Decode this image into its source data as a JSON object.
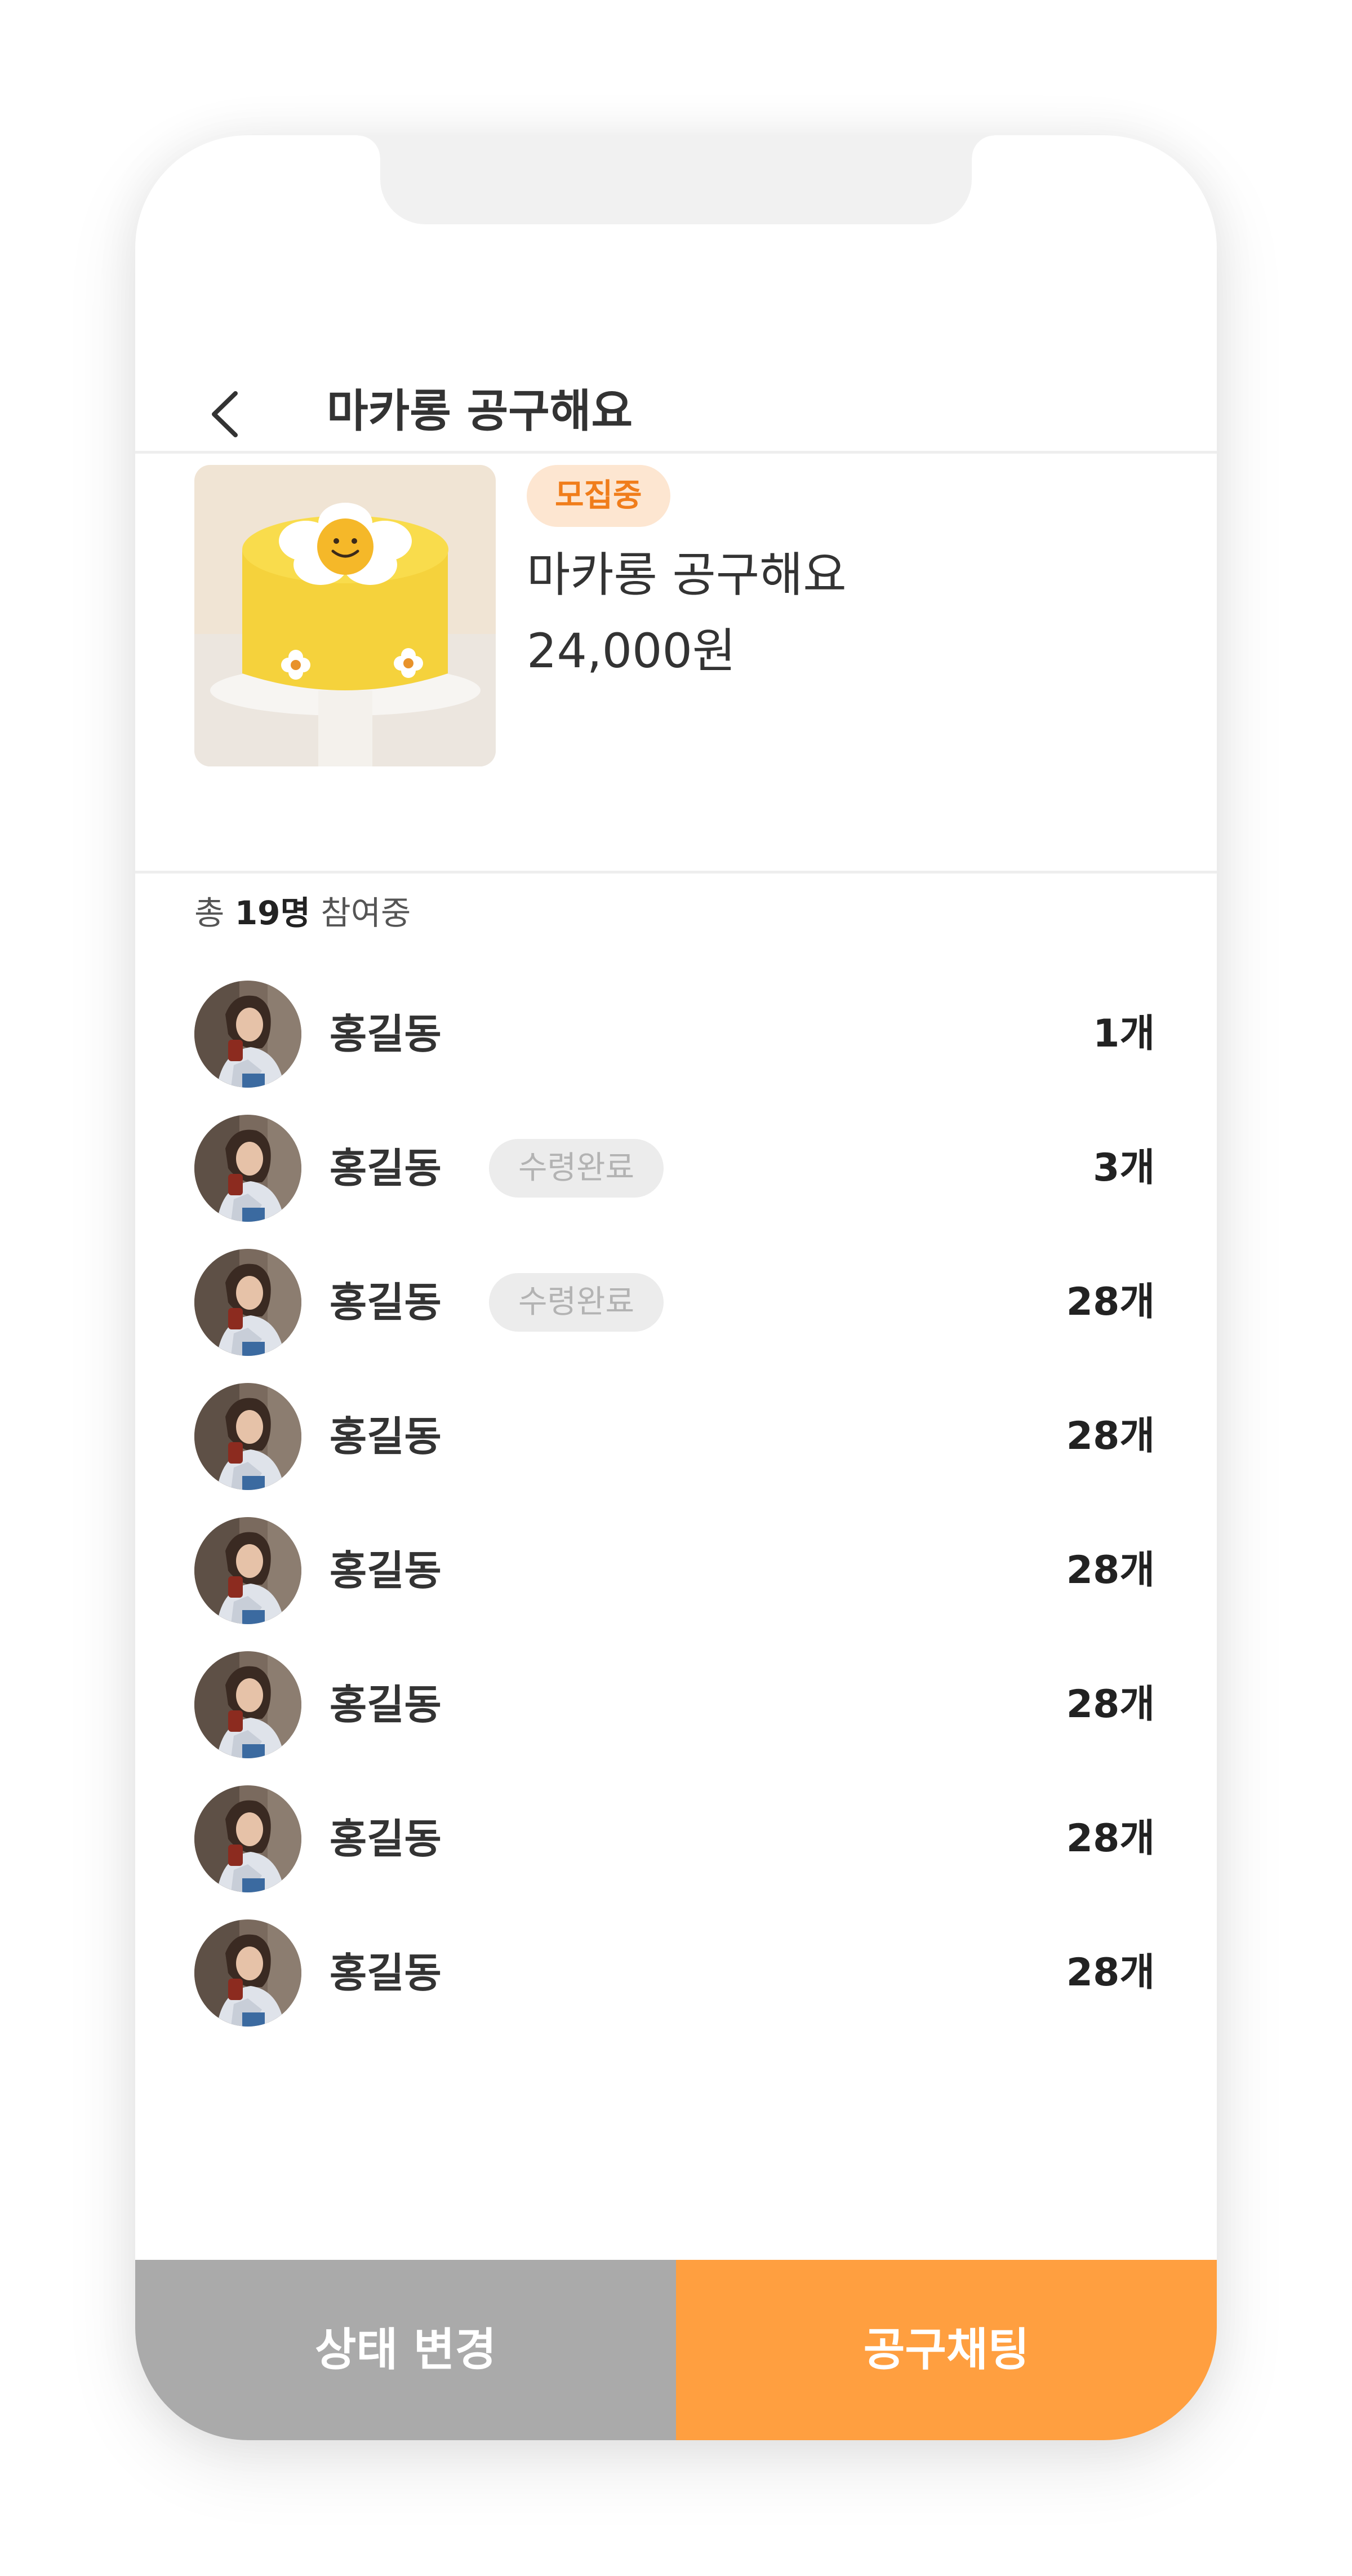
{
  "header": {
    "title": "마카롱 공구해요",
    "back_icon": "chevron-left-icon"
  },
  "product": {
    "status_badge": "모집중",
    "name": "마카롱 공구해요",
    "price": "24,000원",
    "image": "yellow-flower-cake-image"
  },
  "participants": {
    "summary_prefix": "총",
    "summary_count": "19명",
    "summary_suffix": "참여중",
    "rows": [
      {
        "name": "홍길동",
        "badge": "",
        "qty": "1개"
      },
      {
        "name": "홍길동",
        "badge": "수령완료",
        "qty": "3개"
      },
      {
        "name": "홍길동",
        "badge": "수령완료",
        "qty": "28개"
      },
      {
        "name": "홍길동",
        "badge": "",
        "qty": "28개"
      },
      {
        "name": "홍길동",
        "badge": "",
        "qty": "28개"
      },
      {
        "name": "홍길동",
        "badge": "",
        "qty": "28개"
      },
      {
        "name": "홍길동",
        "badge": "",
        "qty": "28개"
      },
      {
        "name": "홍길동",
        "badge": "",
        "qty": "28개"
      }
    ]
  },
  "actions": {
    "change_status_label": "상태 변경",
    "group_chat_label": "공구채팅"
  },
  "colors": {
    "accent": "#ff9f40",
    "badge_bg": "#fde6d1",
    "badge_text": "#f07d1b",
    "secondary_button": "#aaaaaa",
    "received_badge_bg": "#ececec",
    "received_badge_text": "#b3b3b3"
  }
}
